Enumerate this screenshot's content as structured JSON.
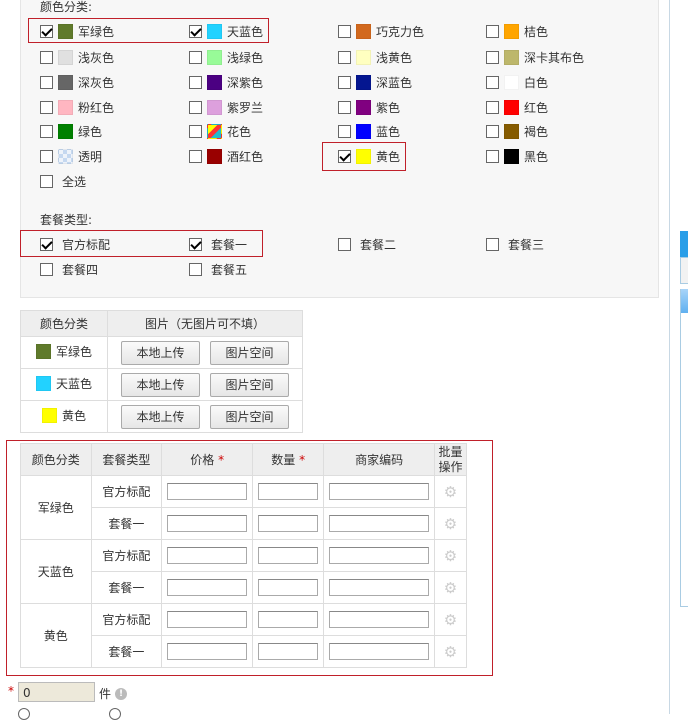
{
  "colors": {
    "label": "颜色分类:",
    "items": [
      {
        "label": "军绿色",
        "swatch": "#5f7a2b",
        "checked": true
      },
      {
        "label": "天蓝色",
        "swatch": "#22d2ff",
        "checked": true
      },
      {
        "label": "巧克力色",
        "swatch": "#d2691e",
        "checked": false
      },
      {
        "label": "桔色",
        "swatch": "#ffa500",
        "checked": false
      },
      {
        "label": "浅灰色",
        "swatch": "#e0e0e0",
        "checked": false
      },
      {
        "label": "浅绿色",
        "swatch": "#98fb98",
        "checked": false
      },
      {
        "label": "浅黄色",
        "swatch": "#ffffc0",
        "checked": false
      },
      {
        "label": "深卡其布色",
        "swatch": "#bdb76b",
        "checked": false
      },
      {
        "label": "深灰色",
        "swatch": "#666666",
        "checked": false
      },
      {
        "label": "深紫色",
        "swatch": "#4b0082",
        "checked": false
      },
      {
        "label": "深蓝色",
        "swatch": "#041690",
        "checked": false
      },
      {
        "label": "白色",
        "swatch": "#ffffff",
        "checked": false
      },
      {
        "label": "粉红色",
        "swatch": "#ffb6c1",
        "checked": false
      },
      {
        "label": "紫罗兰",
        "swatch": "#dda0dd",
        "checked": false
      },
      {
        "label": "紫色",
        "swatch": "#800080",
        "checked": false
      },
      {
        "label": "红色",
        "swatch": "#ff0000",
        "checked": false
      },
      {
        "label": "绿色",
        "swatch": "#008000",
        "checked": false
      },
      {
        "label": "花色",
        "swatch": "multicolor",
        "checked": false
      },
      {
        "label": "蓝色",
        "swatch": "#0000ff",
        "checked": false
      },
      {
        "label": "褐色",
        "swatch": "#855b00",
        "checked": false
      },
      {
        "label": "透明",
        "swatch": "transparent",
        "checked": false
      },
      {
        "label": "酒红色",
        "swatch": "#990000",
        "checked": false
      },
      {
        "label": "黄色",
        "swatch": "#ffff00",
        "checked": true
      },
      {
        "label": "黑色",
        "swatch": "#000000",
        "checked": false
      }
    ],
    "select_all": "全选"
  },
  "packages": {
    "label": "套餐类型:",
    "items": [
      {
        "label": "官方标配",
        "checked": true
      },
      {
        "label": "套餐一",
        "checked": true
      },
      {
        "label": "套餐二",
        "checked": false
      },
      {
        "label": "套餐三",
        "checked": false
      },
      {
        "label": "套餐四",
        "checked": false
      },
      {
        "label": "套餐五",
        "checked": false
      }
    ]
  },
  "images": {
    "headers": [
      "颜色分类",
      "图片（无图片可不填）"
    ],
    "rows": [
      {
        "label": "军绿色",
        "swatch": "#5f7a2b"
      },
      {
        "label": "天蓝色",
        "swatch": "#22d2ff"
      },
      {
        "label": "黄色",
        "swatch": "#ffff00"
      }
    ],
    "upload_label": "本地上传",
    "space_label": "图片空间"
  },
  "sku": {
    "headers": [
      "颜色分类",
      "套餐类型",
      "价格",
      "数量",
      "商家编码",
      "批量操作"
    ],
    "required_mark": "*",
    "groups": [
      {
        "color": "军绿色",
        "packages": [
          "官方标配",
          "套餐一"
        ]
      },
      {
        "color": "天蓝色",
        "packages": [
          "官方标配",
          "套餐一"
        ]
      },
      {
        "color": "黄色",
        "packages": [
          "官方标配",
          "套餐一"
        ]
      }
    ]
  },
  "quantity": {
    "required_mark": "*",
    "value": "0",
    "unit": "件"
  }
}
